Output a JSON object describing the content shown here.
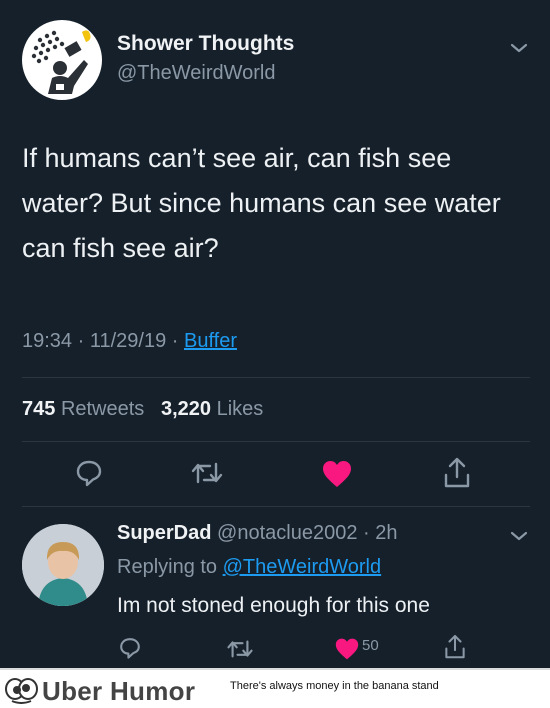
{
  "tweet": {
    "display_name": "Shower Thoughts",
    "handle": "@TheWeirdWorld",
    "text": "If humans can’t see air, can fish see water? But since humans can see water can fish see air?",
    "time": "19:34",
    "date": "11/29/19",
    "source": "Buffer",
    "retweets": "745",
    "retweets_label": "Retweets",
    "likes": "3,220",
    "likes_label": "Likes"
  },
  "reply": {
    "display_name": "SuperDad",
    "handle": "@notaclue2002",
    "age": "2h",
    "replying_prefix": "Replying to",
    "replying_to": "@TheWeirdWorld",
    "text": "Im not stoned enough for this one",
    "like_count": "50"
  },
  "footer": {
    "brand": "Uber Humor",
    "tagline": "There's always money in the banana stand"
  },
  "icons": [
    "reply-icon",
    "retweet-icon",
    "like-icon",
    "share-icon",
    "chevron-down-icon"
  ],
  "colors": {
    "background": "#15202b",
    "link": "#1d9bf0",
    "like": "#f91880",
    "muted": "#8b98a5"
  }
}
